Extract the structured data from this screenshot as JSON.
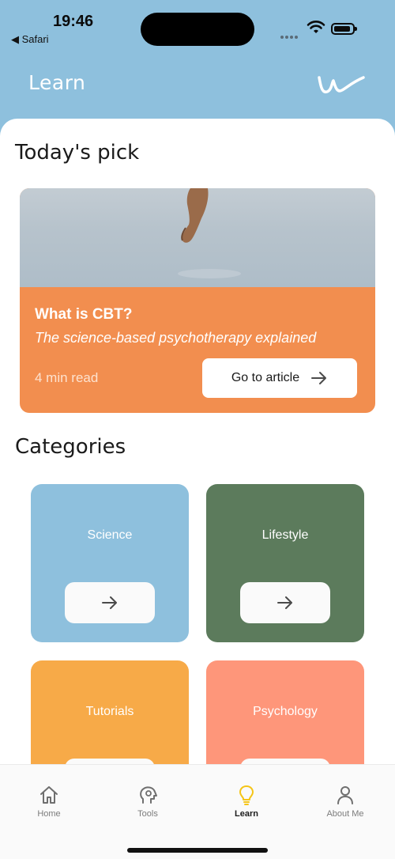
{
  "status_bar": {
    "time": "19:46",
    "back_app": "◀ Safari"
  },
  "header": {
    "title": "Learn",
    "logo_icon": "app-logo-w"
  },
  "todays_pick": {
    "section_title": "Today's pick",
    "article": {
      "title": "What is CBT?",
      "subtitle": "The science-based psychotherapy explained",
      "read_time": "4 min read",
      "button_label": "Go to article",
      "button_icon": "arrow-right-icon"
    }
  },
  "categories": {
    "section_title": "Categories",
    "items": [
      {
        "label": "Science",
        "color": "#8ec0dd"
      },
      {
        "label": "Lifestyle",
        "color": "#5c7b5c"
      },
      {
        "label": "Tutorials",
        "color": "#f7aa48"
      },
      {
        "label": "Psychology",
        "color": "#fe967a"
      }
    ]
  },
  "tabbar": {
    "items": [
      {
        "label": "Home",
        "icon": "home-icon",
        "active": false
      },
      {
        "label": "Tools",
        "icon": "head-gear-icon",
        "active": false
      },
      {
        "label": "Learn",
        "icon": "lightbulb-icon",
        "active": true
      },
      {
        "label": "About Me",
        "icon": "person-icon",
        "active": false
      }
    ]
  },
  "colors": {
    "header_bg": "#8ec0dd",
    "card_bg": "#f28e4f",
    "active_tab_icon": "#f5c518"
  }
}
